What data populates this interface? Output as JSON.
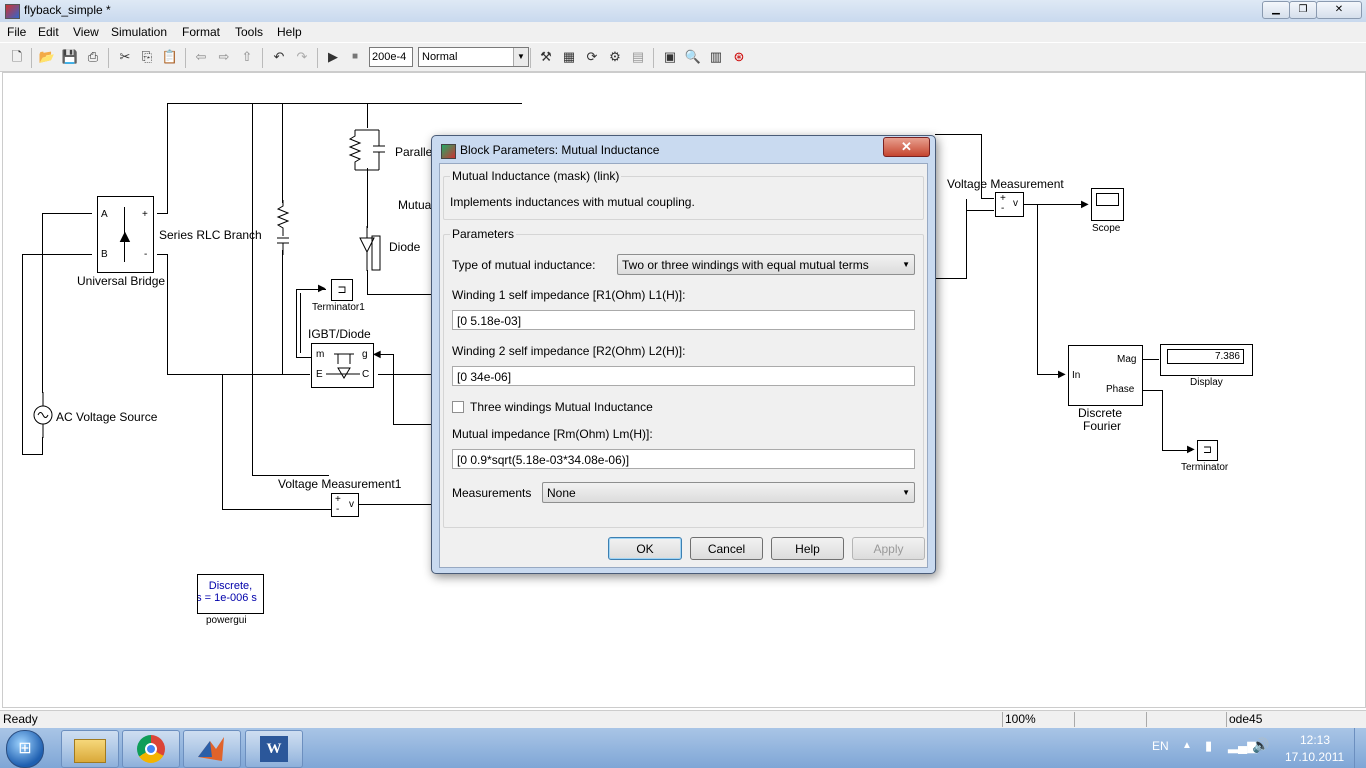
{
  "window": {
    "title": "flyback_simple *"
  },
  "menu": [
    "File",
    "Edit",
    "View",
    "Simulation",
    "Format",
    "Tools",
    "Help"
  ],
  "toolbar": {
    "stop_time": "200e-4",
    "sim_mode": "Normal"
  },
  "diagram": {
    "universal_bridge": {
      "label": "Universal Bridge",
      "port_a": "A",
      "port_b": "B",
      "port_plus": "+",
      "port_minus": "-"
    },
    "series_rlc": "Series RLC Branch",
    "parallel_rlc": "Paralle",
    "mutual": "Mutua",
    "diode": "Diode",
    "terminator1": "Terminator1",
    "igbt": {
      "label": "IGBT/Diode",
      "m": "m",
      "g": "g",
      "e": "E",
      "c": "C"
    },
    "ac_source": "AC Voltage Source",
    "vmeas1": "Voltage Measurement1",
    "vmeas": "Voltage Measurement",
    "scope": "Scope",
    "fourier": {
      "label_1": "Discrete",
      "label_2": "Fourier",
      "in": "In",
      "mag": "Mag",
      "phase": "Phase"
    },
    "display": {
      "label": "Display",
      "value": "7.386"
    },
    "terminator": "Terminator",
    "powergui": {
      "label": "powergui",
      "line1": "Discrete,",
      "line2": "s = 1e-006 s"
    },
    "vm_plus": "+",
    "vm_minus": "-",
    "vm_v": "v"
  },
  "dialog": {
    "title": "Block Parameters: Mutual Inductance",
    "mask_title": "Mutual Inductance (mask) (link)",
    "description": "Implements inductances with mutual coupling.",
    "params_header": "Parameters",
    "type_label": "Type of mutual inductance:",
    "type_value": "Two or three windings with equal mutual terms",
    "w1_label": "Winding 1 self impedance [R1(Ohm) L1(H)]:",
    "w1_value": "[0 5.18e-03]",
    "w2_label": "Winding 2 self impedance [R2(Ohm) L2(H)]:",
    "w2_value": "[0 34e-06]",
    "three_label": "Three windings Mutual Inductance",
    "three_checked": false,
    "mutual_label": "Mutual impedance [Rm(Ohm) Lm(H)]:",
    "mutual_value": "[0 0.9*sqrt(5.18e-03*34.08e-06)]",
    "meas_label": "Measurements",
    "meas_value": "None",
    "buttons": {
      "ok": "OK",
      "cancel": "Cancel",
      "help": "Help",
      "apply": "Apply"
    }
  },
  "status": {
    "text": "Ready",
    "zoom": "100%",
    "solver": "ode45"
  },
  "taskbar": {
    "lang": "EN",
    "time": "12:13",
    "date": "17.10.2011"
  }
}
